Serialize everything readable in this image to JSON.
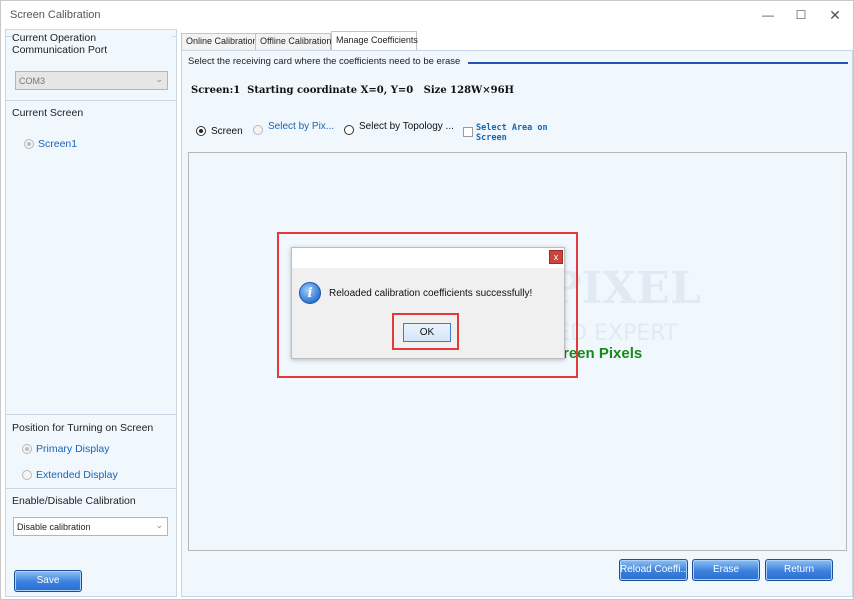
{
  "window": {
    "title": "Screen Calibration",
    "controls": {
      "minimize": "—",
      "maximize": "☐",
      "close": "✕"
    }
  },
  "left_panel": {
    "comm_port": {
      "label": "Current Operation Communication Port",
      "value": "COM3"
    },
    "current_screen": {
      "label": "Current Screen",
      "item": "Screen1"
    },
    "position": {
      "label": "Position for Turning on Screen",
      "primary": "Primary Display",
      "extended": "Extended Display"
    },
    "calibration": {
      "label": "Enable/Disable Calibration",
      "value": "Disable calibration"
    },
    "save_label": "Save"
  },
  "tabs": [
    {
      "label": "Online Calibration",
      "active": false
    },
    {
      "label": "Offline Calibration",
      "active": false
    },
    {
      "label": "Manage Coefficients",
      "active": true
    }
  ],
  "manage": {
    "legend": "Select the receiving card where the coefficients need to be erase",
    "screen_info": "Screen:1  Starting coordinate X=0, Y=0   Size 128W×96H",
    "options": {
      "screen": "Screen",
      "by_pixel": "Select by Pix...",
      "by_topology": "Select by Topology ...",
      "area": "Select Area on Screen"
    },
    "canvas_partial_text": "reen Pixels",
    "watermark_main": "VERY PIXEL",
    "watermark_sub": "LED EXPERT",
    "buttons": {
      "reload": "Reload Coeffi...",
      "erase": "Erase",
      "return": "Return"
    }
  },
  "dialog": {
    "close": "x",
    "message": "Reloaded calibration coefficients successfully!",
    "ok": "OK"
  },
  "colors": {
    "accent_blue": "#2a6fd0",
    "highlight_red": "#e03a3a",
    "info_green": "#178a17"
  }
}
